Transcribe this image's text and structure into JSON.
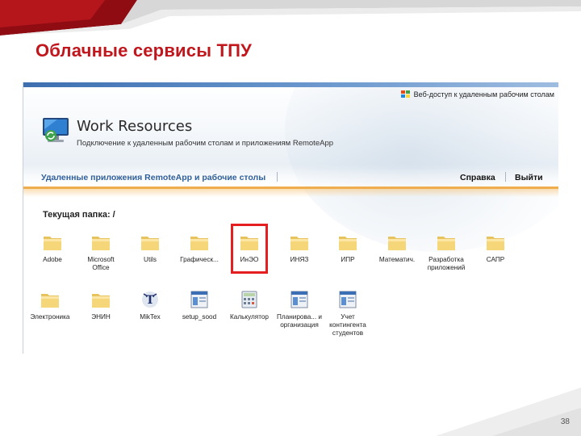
{
  "slide": {
    "title": "Облачные сервисы ТПУ",
    "page_number": "38",
    "accent": "#c0161c"
  },
  "header": {
    "web_access": "Веб-доступ к удаленным рабочим столам",
    "brand_title": "Work Resources",
    "brand_subtitle": "Подключение к удаленным рабочим столам и приложениям RemoteApp"
  },
  "nav": {
    "section": "Удаленные приложения RemoteApp и рабочие столы",
    "help": "Справка",
    "exit": "Выйти"
  },
  "current_folder": "Текущая папка: /",
  "items": [
    {
      "label": "Adobe",
      "icon": "folder-icon"
    },
    {
      "label": "Microsoft Office",
      "icon": "folder-icon"
    },
    {
      "label": "Utils",
      "icon": "folder-icon"
    },
    {
      "label": "Графическ...",
      "icon": "folder-icon"
    },
    {
      "label": "ИнЭО",
      "icon": "folder-icon"
    },
    {
      "label": "ИНЯЗ",
      "icon": "folder-icon"
    },
    {
      "label": "ИПР",
      "icon": "folder-icon"
    },
    {
      "label": "Математич.",
      "icon": "folder-icon"
    },
    {
      "label": "Разработка приложений",
      "icon": "folder-icon"
    },
    {
      "label": "САПР",
      "icon": "folder-icon"
    },
    {
      "label": "Электроника",
      "icon": "folder-icon"
    },
    {
      "label": "ЭНИН",
      "icon": "folder-icon"
    },
    {
      "label": "MikTex",
      "icon": "tex-app-icon"
    },
    {
      "label": "setup_sood",
      "icon": "remoteapp-icon"
    },
    {
      "label": "Калькулятор",
      "icon": "calculator-icon"
    },
    {
      "label": "Планирова... и организация",
      "icon": "remoteapp-icon"
    },
    {
      "label": "Учет контингента студентов",
      "icon": "remoteapp-icon"
    }
  ]
}
